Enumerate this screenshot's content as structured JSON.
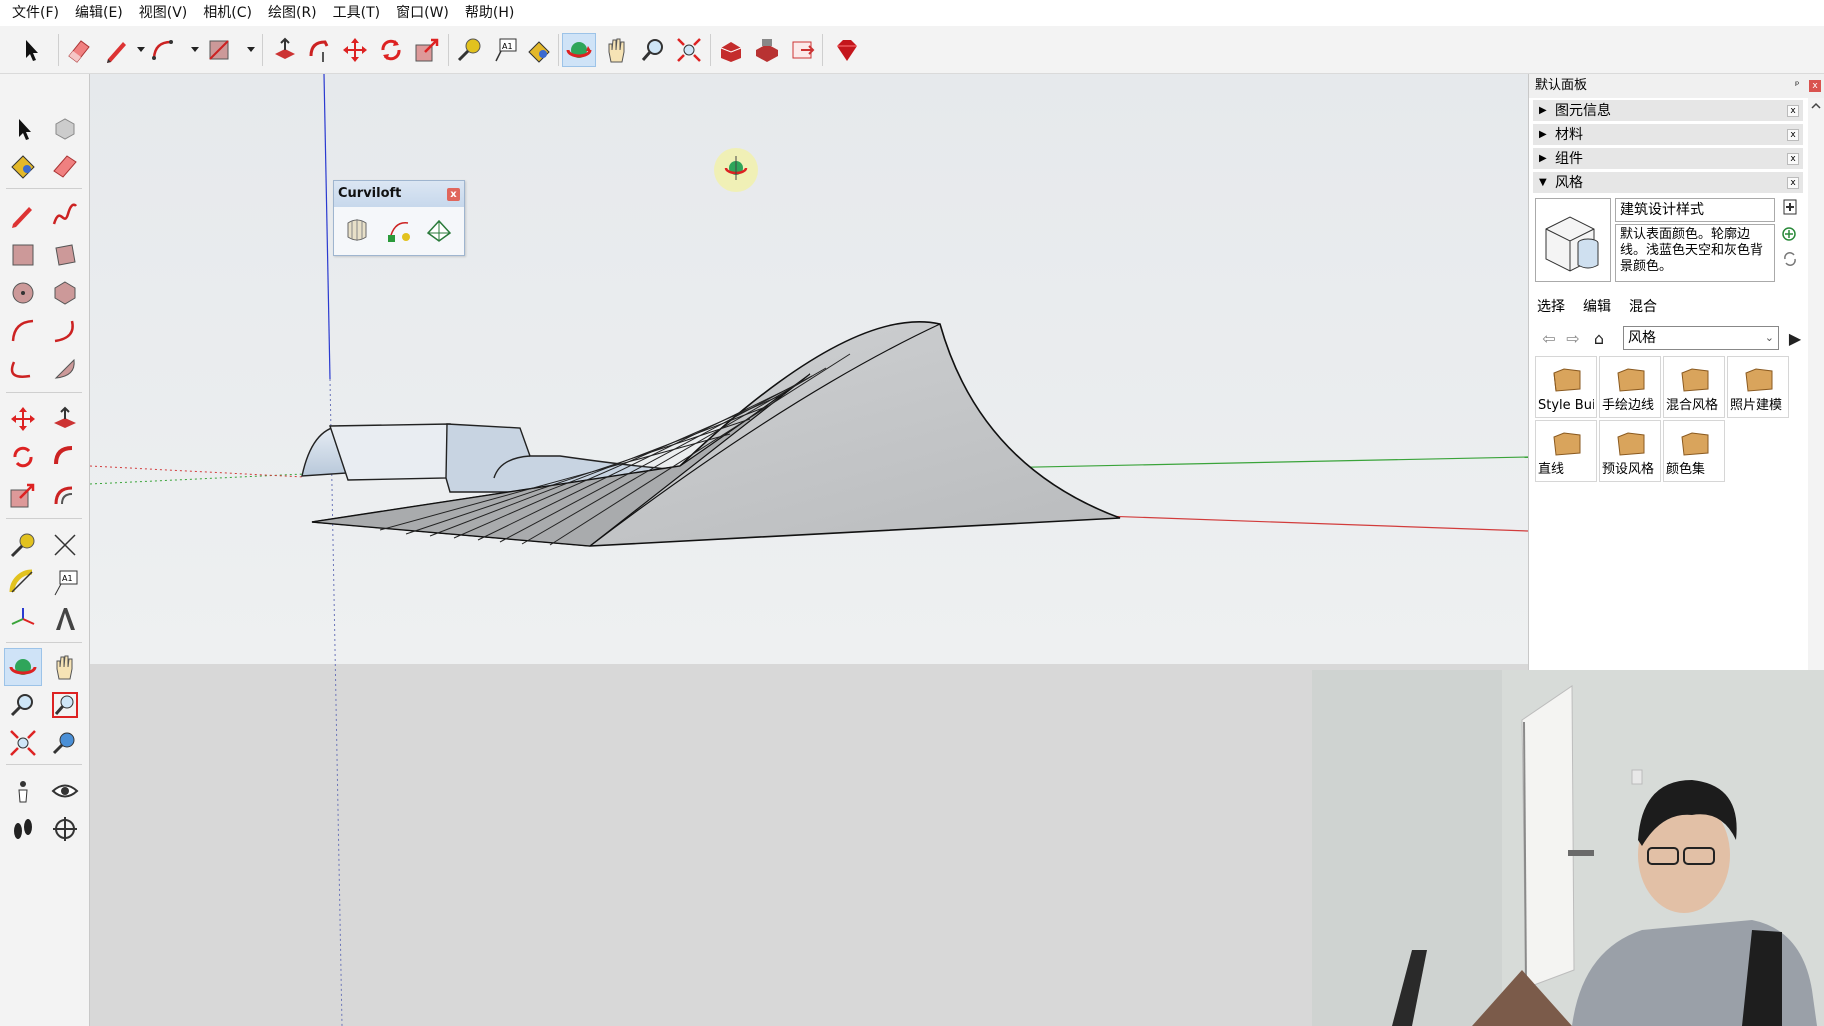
{
  "menu": [
    "文件(F)",
    "编辑(E)",
    "视图(V)",
    "相机(C)",
    "绘图(R)",
    "工具(T)",
    "窗口(W)",
    "帮助(H)"
  ],
  "curviloft": {
    "title": "Curviloft",
    "close": "x"
  },
  "tray": {
    "title": "默认面板",
    "pin": "ᵖ",
    "close": "x",
    "sections": [
      {
        "label": "图元信息",
        "expanded": false
      },
      {
        "label": "材料",
        "expanded": false
      },
      {
        "label": "组件",
        "expanded": false
      },
      {
        "label": "风格",
        "expanded": true
      }
    ],
    "section_close": "x",
    "collapsed_arrow": "▶",
    "expanded_arrow": "▼",
    "style": {
      "name": "建筑设计样式",
      "description": "默认表面颜色。轮廓边线。浅蓝色天空和灰色背景颜色。"
    },
    "tabs": [
      "选择",
      "编辑",
      "混合"
    ],
    "active_tab": "选择",
    "nav": {
      "back": "⇦",
      "forward": "⇨",
      "home": "⌂",
      "select_value": "风格",
      "select_chevron": "⌄",
      "details": "▶"
    },
    "folders": [
      "Style Builder",
      "手绘边线",
      "混合风格",
      "照片建模",
      "直线",
      "预设风格",
      "颜色集"
    ]
  },
  "colors": {
    "sky": "#e6e9ec",
    "ground": "#d8d8d8",
    "axis_red": "#d23c3c",
    "axis_green": "#3aa43a",
    "axis_blue": "#2a3ad0",
    "selection": "#cfe3f7"
  },
  "icons": {
    "toolbar": [
      "select-icon",
      "eraser-icon",
      "pencil-icon",
      "arc-icon",
      "rectangle-icon",
      "pushpull-icon",
      "followme-icon",
      "move-icon",
      "rotate-icon",
      "scale-icon",
      "tape-icon",
      "text-icon",
      "paint-icon",
      "orbit-icon",
      "pan-icon",
      "zoom-icon",
      "zoom-extents-icon",
      "warehouse-icon",
      "extension-warehouse-icon",
      "send-layout-icon",
      "ruby-icon"
    ]
  }
}
